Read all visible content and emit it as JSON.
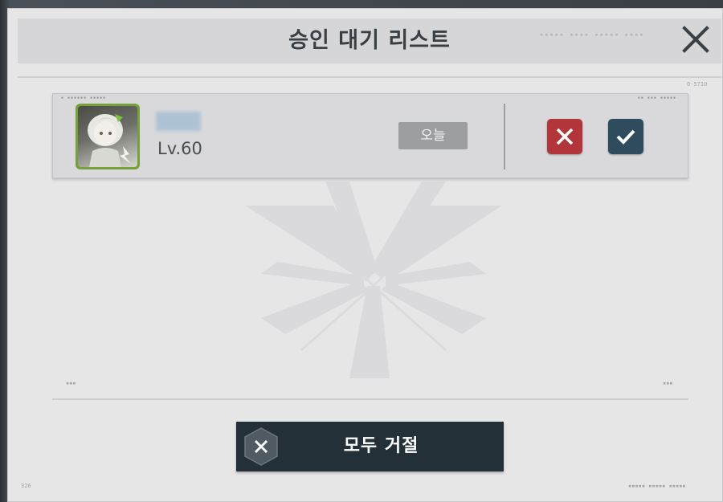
{
  "dialog": {
    "title": "승인 대기 리스트"
  },
  "request": {
    "level": "Lv.60",
    "date_badge": "오늘"
  },
  "footer": {
    "reject_all_label": "모두 거절"
  },
  "icons": {
    "close": "close-icon",
    "reject": "x-icon",
    "accept": "check-icon",
    "reject_all": "x-icon"
  },
  "colors": {
    "reject": "#b2353a",
    "accept": "#2e4c5e",
    "reject_all_bg": "#243038",
    "avatar_frame": "#75a13c"
  }
}
